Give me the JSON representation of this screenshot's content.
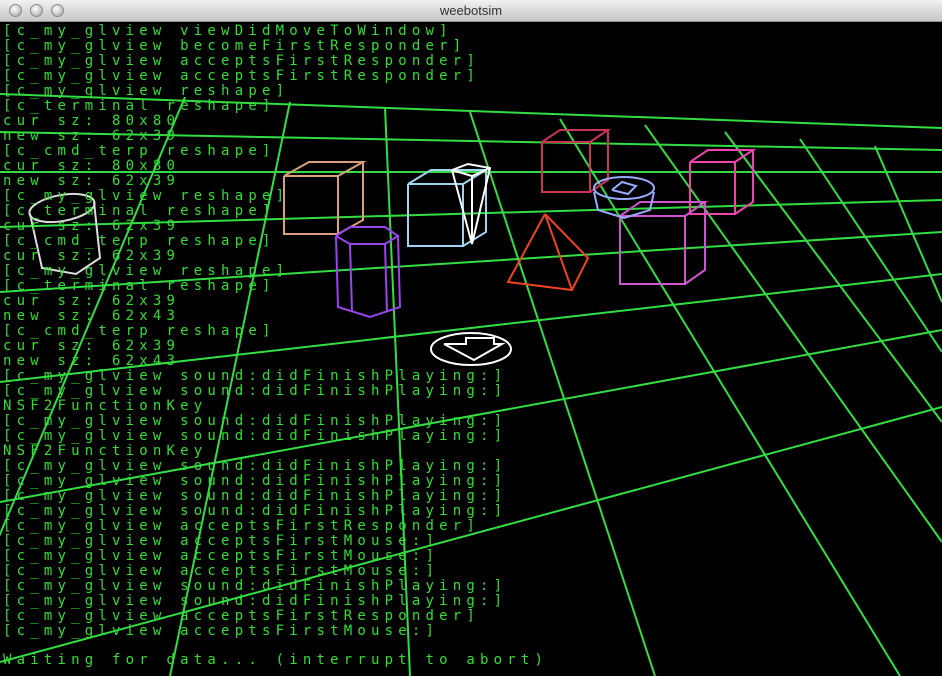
{
  "window": {
    "title": "weebotsim",
    "buttons": [
      "close-button",
      "minimize-button",
      "zoom-button"
    ]
  },
  "terminal": {
    "lines": [
      "[c_my_glview viewDidMoveToWindow]",
      "[c_my_glview becomeFirstResponder]",
      "[c_my_glview acceptsFirstResponder]",
      "[c_my_glview acceptsFirstResponder]",
      "[c_my_glview reshape]",
      "[c_terminal reshape]",
      "cur sz: 80x80",
      "new sz: 62x39",
      "[c_cmd_terp reshape]",
      "cur sz: 80x80",
      "new sz: 62x39",
      "[c_my_glview reshape]",
      "[c_terminal reshape]",
      "cur sz: 62x39",
      "[c_cmd_terp reshape]",
      "cur sz: 62x39",
      "[c_my_glview reshape]",
      "[c_terminal reshape]",
      "cur sz: 62x39",
      "new sz: 62x43",
      "[c_cmd_terp reshape]",
      "cur sz: 62x39",
      "new sz: 62x43",
      "[c_my_glview sound:didFinishPlaying:]",
      "[c_my_glview sound:didFinishPlaying:]",
      "NSF2FunctionKey",
      "[c_my_glview sound:didFinishPlaying:]",
      "[c_my_glview sound:didFinishPlaying:]",
      "NSF2FunctionKey",
      "[c_my_glview sound:didFinishPlaying:]",
      "[c_my_glview sound:didFinishPlaying:]",
      "[c_my_glview sound:didFinishPlaying:]",
      "[c_my_glview sound:didFinishPlaying:]",
      "[c_my_glview acceptsFirstResponder]",
      "[c_my_glview acceptsFirstMouse:]",
      "[c_my_glview acceptsFirstMouse:]",
      "[c_my_glview acceptsFirstMouse:]",
      "[c_my_glview sound:didFinishPlaying:]",
      "[c_my_glview sound:didFinishPlaying:]",
      "[c_my_glview acceptsFirstResponder]",
      "[c_my_glview acceptsFirstMouse:]"
    ],
    "prompt": "Waiting for data... (interrupt to abort)",
    "text_color": "#33dd33"
  },
  "scene": {
    "background": "#000000",
    "grid_color": "#33dd44",
    "objects": [
      {
        "name": "tan-cube",
        "shape": "cube",
        "color": "#d9a07a"
      },
      {
        "name": "purple-prism",
        "shape": "hexagonal-prism",
        "color": "#9944ee"
      },
      {
        "name": "light-blue-cube",
        "shape": "cube",
        "color": "#9fd4f0"
      },
      {
        "name": "white-cone-robot",
        "shape": "inverted-cone",
        "color": "#ffffff"
      },
      {
        "name": "red-pyramid",
        "shape": "pyramid",
        "color": "#ee4422"
      },
      {
        "name": "crimson-cube",
        "shape": "cube",
        "color": "#cc3355"
      },
      {
        "name": "pink-cube",
        "shape": "cube",
        "color": "#ee44aa"
      },
      {
        "name": "magenta-cube",
        "shape": "cube",
        "color": "#cc55cc"
      },
      {
        "name": "blue-disc-robot",
        "shape": "disc",
        "color": "#99aaff"
      },
      {
        "name": "white-disc-robot",
        "shape": "disc",
        "color": "#ffffff"
      },
      {
        "name": "white-cylinder",
        "shape": "cylinder",
        "color": "#dddddd"
      }
    ]
  }
}
